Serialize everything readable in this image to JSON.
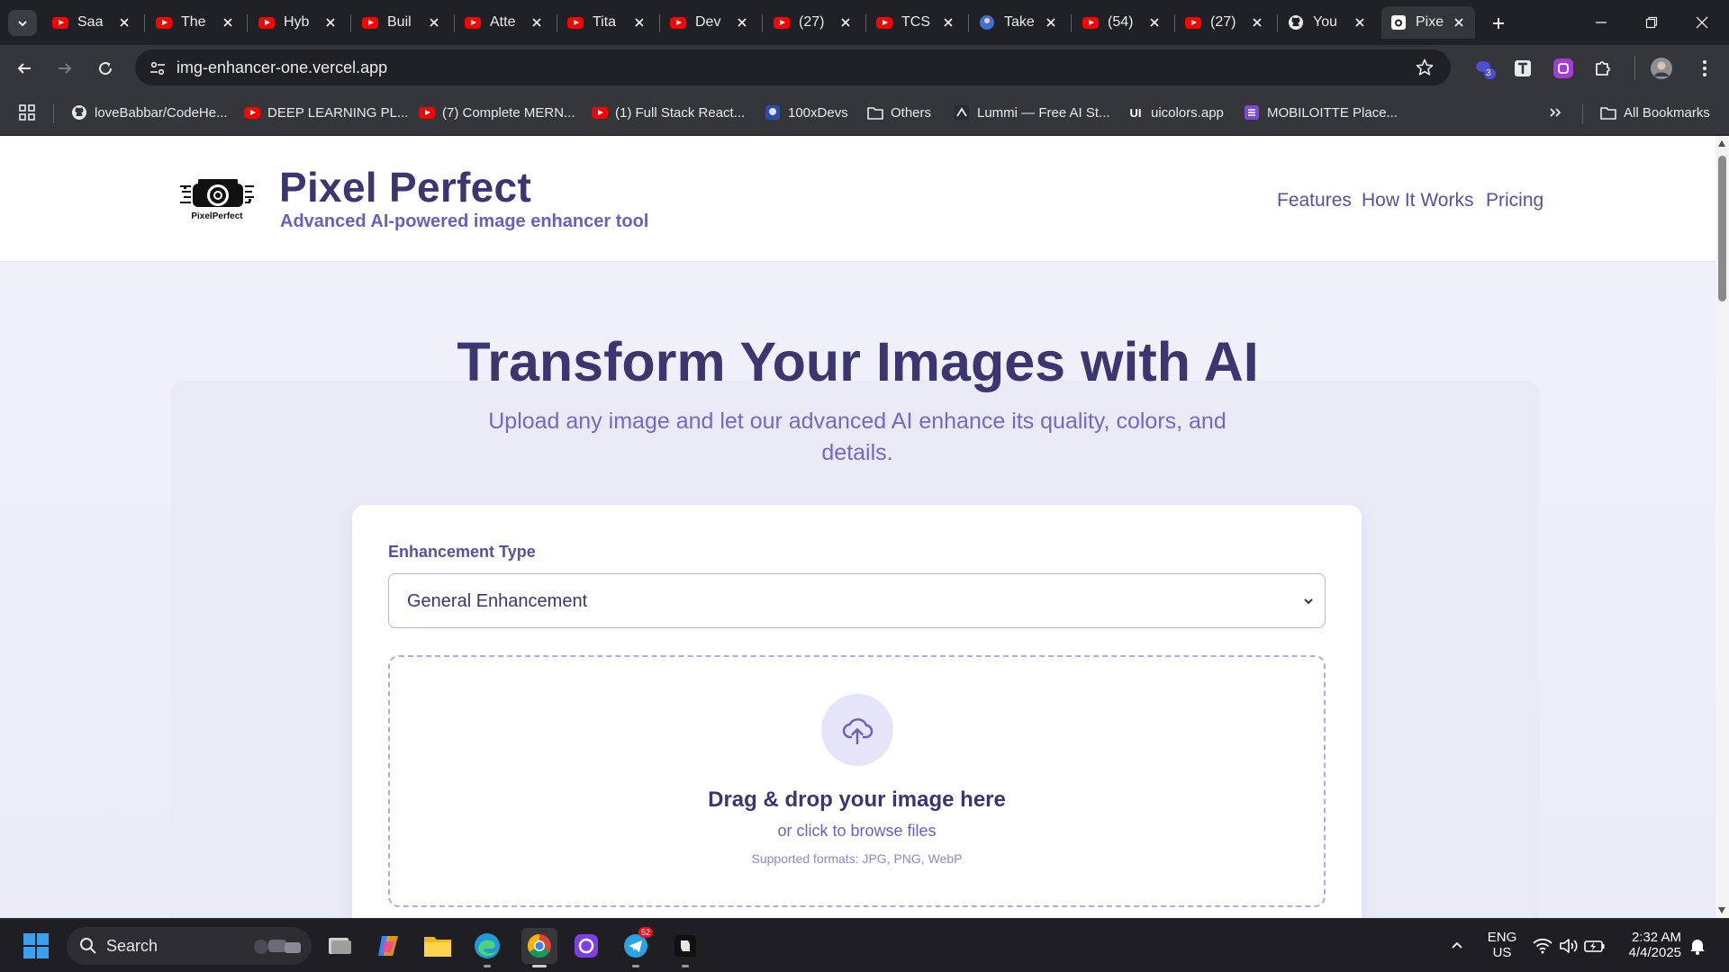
{
  "browser": {
    "tabs": [
      {
        "title": "Saa",
        "favicon": "youtube-icon"
      },
      {
        "title": "The",
        "favicon": "youtube-icon"
      },
      {
        "title": "Hyb",
        "favicon": "youtube-icon"
      },
      {
        "title": "Buil",
        "favicon": "youtube-icon"
      },
      {
        "title": "Atte",
        "favicon": "youtube-icon"
      },
      {
        "title": "Tita",
        "favicon": "youtube-icon"
      },
      {
        "title": "Dev",
        "favicon": "youtube-icon"
      },
      {
        "title": "(27)",
        "favicon": "youtube-icon"
      },
      {
        "title": "TCS",
        "favicon": "youtube-icon"
      },
      {
        "title": "Take",
        "favicon": "globe-icon"
      },
      {
        "title": "(54)",
        "favicon": "youtube-icon"
      },
      {
        "title": "(27)",
        "favicon": "youtube-icon"
      },
      {
        "title": "You",
        "favicon": "github-icon"
      },
      {
        "title": "Pixe",
        "favicon": "pixelperfect-icon",
        "active": true
      }
    ],
    "url": "img-enhancer-one.vercel.app",
    "extension_badge": "3",
    "bookmarks": [
      {
        "label": "loveBabbar/CodeHe...",
        "icon": "github-icon"
      },
      {
        "label": "DEEP LEARNING PL...",
        "icon": "youtube-icon"
      },
      {
        "label": "(7) Complete MERN...",
        "icon": "youtube-icon"
      },
      {
        "label": "(1) Full Stack React...",
        "icon": "youtube-icon"
      },
      {
        "label": "100xDevs",
        "icon": "avatar-icon"
      },
      {
        "label": "Others",
        "icon": "folder-icon"
      },
      {
        "label": "Lummi — Free AI St...",
        "icon": "lummi-icon"
      },
      {
        "label": "uicolors.app",
        "icon": "ui-icon"
      },
      {
        "label": "MOBILOITTE Place...",
        "icon": "list-icon"
      }
    ],
    "all_bookmarks_label": "All Bookmarks"
  },
  "site": {
    "logo_text": "PixelPerfect",
    "brand_title": "Pixel Perfect",
    "brand_subtitle": "Advanced AI-powered image enhancer tool",
    "nav": [
      "Features",
      "How It Works",
      "Pricing"
    ],
    "hero_title": "Transform Your Images with AI",
    "hero_subtitle": "Upload any image and let our advanced AI enhance its quality, colors, and details.",
    "form": {
      "enhancement_label": "Enhancement Type",
      "enhancement_value": "General Enhancement",
      "dropzone_title": "Drag & drop your image here",
      "dropzone_sub": "or click to browse files",
      "dropzone_formats": "Supported formats: JPG, PNG, WebP"
    },
    "colors": {
      "brand": "#3b3670",
      "accent": "#6a5fc1",
      "page_bg": "#f1f1fb"
    }
  },
  "taskbar": {
    "search_label": "Search",
    "telegram_badge": "52",
    "language": "ENG",
    "region": "US",
    "time": "2:32 AM",
    "date": "4/4/2025"
  }
}
